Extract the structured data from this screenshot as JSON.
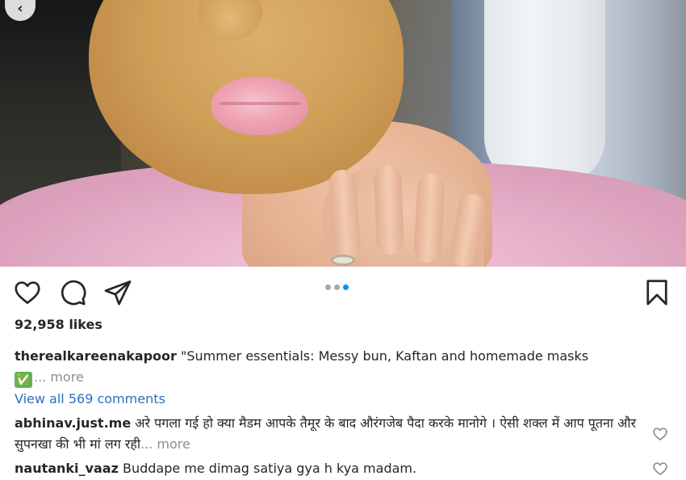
{
  "post": {
    "image_alt": "photo of woman with face mask",
    "likes": "92,958 likes",
    "carousel": {
      "count": 3,
      "active_index": 2,
      "active_color": "#0095f6"
    }
  },
  "caption": {
    "username": "therealkareenakapoor",
    "text": " \"Summer essentials: Messy bun, Kaftan and homemade masks",
    "emoji": "✅",
    "more": "... more"
  },
  "comments_link": "View all 569 comments",
  "comments": [
    {
      "username": "abhinav.just.me",
      "text": " अरे पगला गई हो क्या मैडम आपके तैमूर के बाद औरंगजेब पैदा करके मानोगे । ऐसी शक्ल में आप पूतना और सुपनखा की भी मां लग रही",
      "more": "... more"
    },
    {
      "username": "nautanki_vaaz",
      "text": " Buddape me dimag satiya gya h kya madam."
    }
  ],
  "icons": {
    "back": "chevron-left-icon",
    "like": "heart-icon",
    "comment": "comment-icon",
    "share": "send-icon",
    "save": "bookmark-icon"
  }
}
